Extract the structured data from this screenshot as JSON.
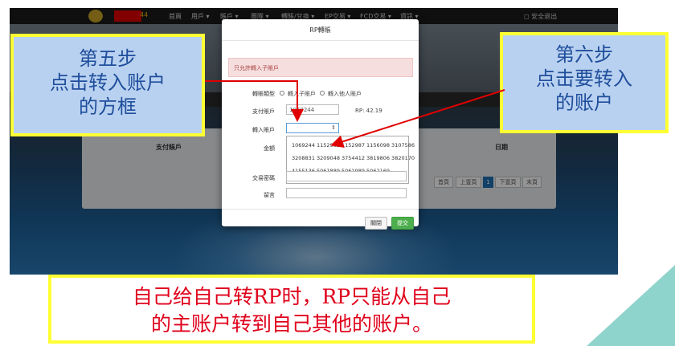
{
  "navbar": {
    "user_id_suffix": "44",
    "items": [
      "首頁",
      "用戶 ▾",
      "賬戶 ▾",
      "團隊 ▾",
      "轉賬/兌換 ▾",
      "EP交易 ▾",
      "FCD交易 ▾",
      "資訊 ▾"
    ],
    "logout": "◻ 安全退出"
  },
  "table": {
    "headers": [
      "支付賬戶",
      "日期"
    ],
    "pagination": [
      "首頁",
      "上壹頁",
      "1",
      "下壹頁",
      "末頁"
    ]
  },
  "modal": {
    "title": "RP轉賬",
    "alert": "只允許轉入子賬戶",
    "transfer_type_label": "轉賬類型",
    "option_self": "轉入子賬戶",
    "option_other": "轉入他人賬戶",
    "pay_account_label": "支付賬戶",
    "pay_account_value": "1069244",
    "rp_balance": "RP: 42.19",
    "target_account_label": "轉入賬戶",
    "amount_label": "金額",
    "password_label": "交易密碼",
    "remark_label": "留言",
    "dropdown_lines": [
      "1069244  1152983  1152987  1156098  3107586",
      "3208831  3209048  3754412  3819806  3820170",
      "4155136  5061889  5061989  5062169"
    ],
    "close_button": "關閉",
    "submit_button": "提交"
  },
  "callouts": {
    "left_lines": [
      "第五步",
      "点击转入账户",
      "的方框"
    ],
    "right_lines": [
      "第六步",
      "点击要转入",
      "的账户"
    ],
    "bottom_lines": [
      "自己给自己转RP时，RP只能从自己",
      "的主账户转到自己其他的账户。"
    ]
  },
  "colors": {
    "callout_text": "#1f4e9c",
    "callout_bg": "#b9d1f0",
    "callout_border": "#ffff33",
    "bottom_text": "#e0001b",
    "arrow": "#e00000",
    "submit": "#4cae4c"
  }
}
